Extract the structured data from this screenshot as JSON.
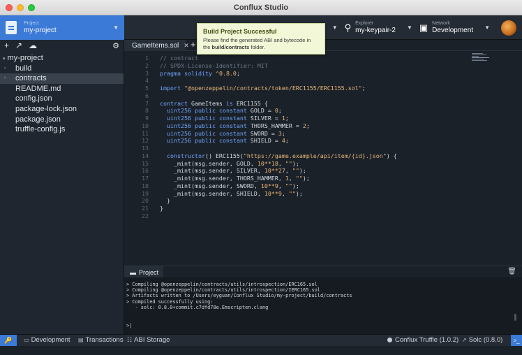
{
  "window": {
    "title": "Conflux Studio"
  },
  "header": {
    "project_small": "Project",
    "project_name": "my-project",
    "explorer_small": "Explorer",
    "explorer_value": "my-keypair-2",
    "network_small": "Network",
    "network_value": "Development"
  },
  "sidebar": {
    "tree": [
      {
        "label": "my-project",
        "arrow": "▾",
        "level": 0
      },
      {
        "label": "build",
        "arrow": "›",
        "level": 1
      },
      {
        "label": "contracts",
        "arrow": "›",
        "level": 1,
        "selected": true
      },
      {
        "label": "README.md",
        "arrow": "",
        "level": 1
      },
      {
        "label": "config.json",
        "arrow": "",
        "level": 1
      },
      {
        "label": "package-lock.json",
        "arrow": "",
        "level": 1
      },
      {
        "label": "package.json",
        "arrow": "",
        "level": 1
      },
      {
        "label": "truffle-config.js",
        "arrow": "",
        "level": 1
      }
    ]
  },
  "editor": {
    "tab_label": "GameItems.sol",
    "lines": [
      "// contract",
      "// SPDX-License-Identifier: MIT",
      "pragma solidity ^0.8.0;",
      "",
      "import \"@openzeppelin/contracts/token/ERC1155/ERC1155.sol\";",
      "",
      "contract GameItems is ERC1155 {",
      "  uint256 public constant GOLD = 0;",
      "  uint256 public constant SILVER = 1;",
      "  uint256 public constant THORS_HAMMER = 2;",
      "  uint256 public constant SWORD = 3;",
      "  uint256 public constant SHIELD = 4;",
      "",
      "  constructor() ERC1155(\"https://game.example/api/item/{id}.json\") {",
      "    _mint(msg.sender, GOLD, 10**18, \"\");",
      "    _mint(msg.sender, SILVER, 10**27, \"\");",
      "    _mint(msg.sender, THORS_HAMMER, 1, \"\");",
      "    _mint(msg.sender, SWORD, 10**9, \"\");",
      "    _mint(msg.sender, SHIELD, 10**9, \"\");",
      "  }",
      "}",
      ""
    ]
  },
  "toast": {
    "title": "Build Project Successful",
    "message_pre": "Please find the generated ABI and bytecode in the ",
    "message_bold": "build/contracts",
    "message_post": " folder."
  },
  "panel": {
    "tab_label": "Project",
    "lines": [
      "> Compiling @openzeppelin/contracts/utils/introspection/ERC165.sol",
      "> Compiling @openzeppelin/contracts/utils/introspection/IERC165.sol",
      "> Artifacts written to /Users/eyguan/Conflux Studio/my-project/build/contracts",
      "> Compiled successfully using:",
      "   - solc: 0.8.0+commit.c7dfd78e.Emscripten.clang"
    ],
    "prompt": ">|"
  },
  "status": {
    "development": "Development",
    "transactions": "Transactions",
    "abi_storage": "ABI Storage",
    "truffle": "Conflux Truffle (1.0.2)",
    "solc": "Solc (0.8.0)"
  },
  "colors": {
    "accent": "#3b7ad6",
    "toast_bg": "#f2f7d7"
  },
  "icons": {
    "project": "file-icon",
    "explorer": "key-icon",
    "network": "server-icon",
    "add": "plus-icon",
    "build": "hammer-icon",
    "deploy": "cloud-icon",
    "settings": "gear-icon"
  }
}
